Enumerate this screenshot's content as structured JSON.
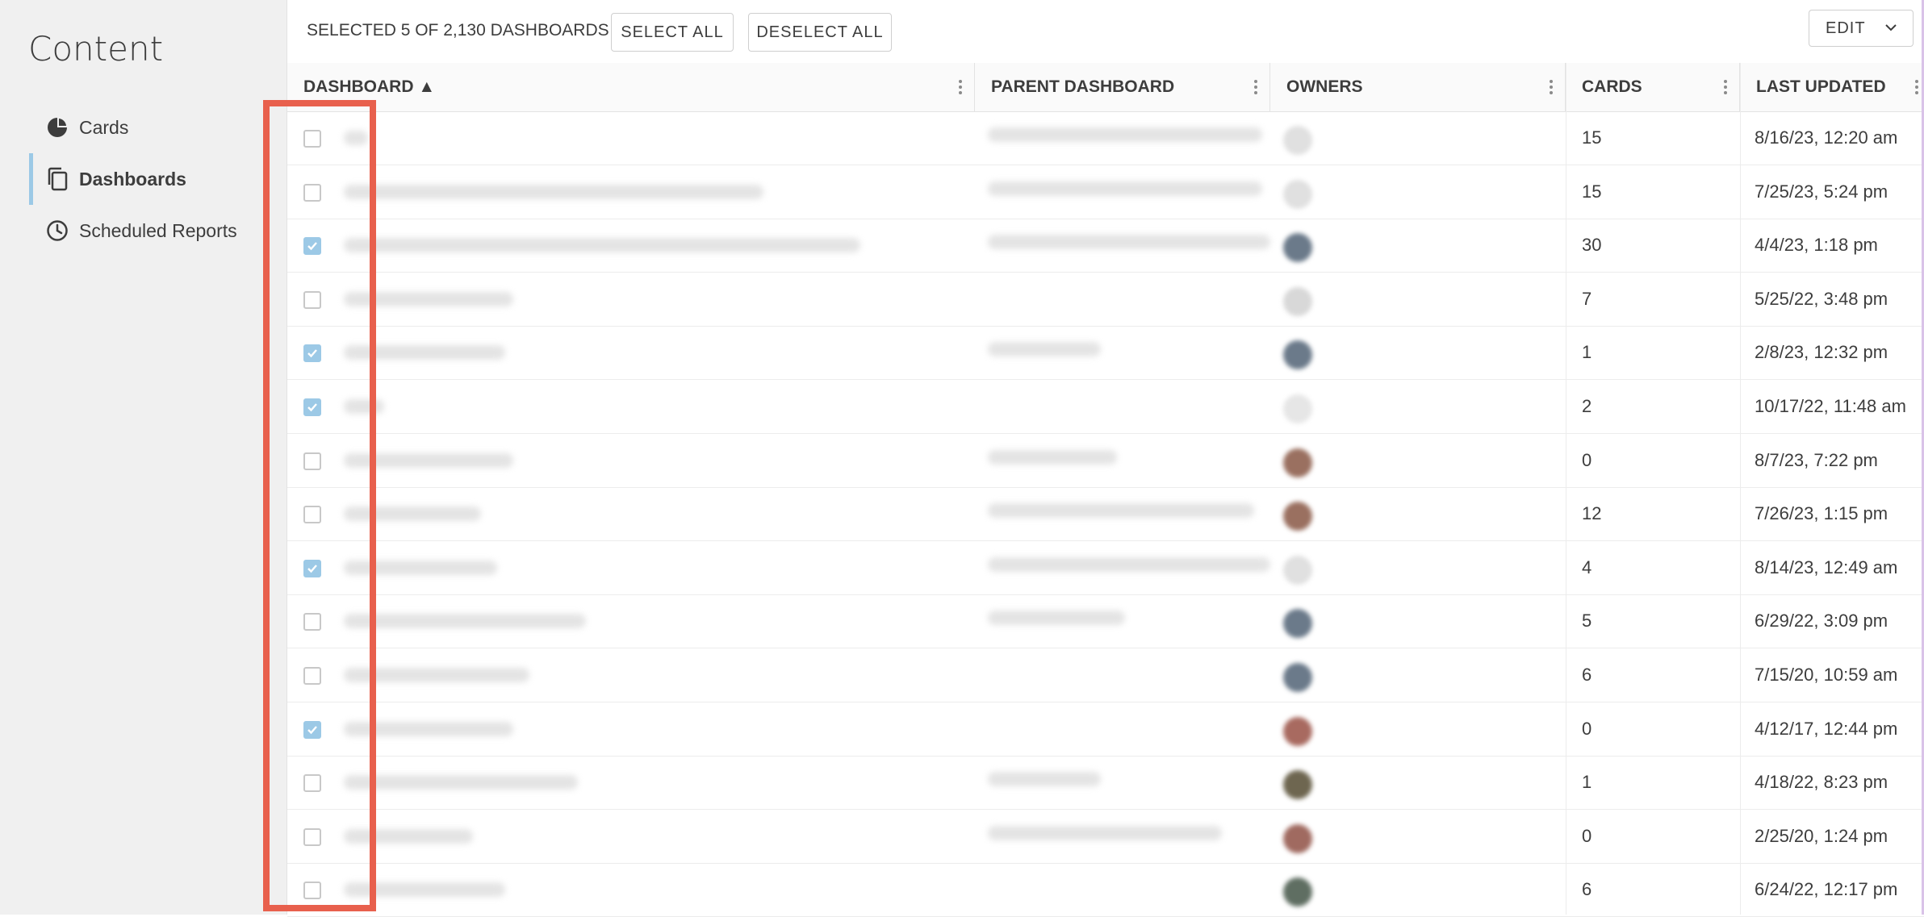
{
  "sidebar": {
    "title": "Content",
    "items": [
      {
        "label": "Cards",
        "icon": "pie-chart-icon",
        "active": false
      },
      {
        "label": "Dashboards",
        "icon": "copy-pages-icon",
        "active": true
      },
      {
        "label": "Scheduled Reports",
        "icon": "clock-icon",
        "active": false
      }
    ]
  },
  "toolbar": {
    "selected_text": "SELECTED 5 OF 2,130 DASHBOARDS",
    "select_all": "SELECT ALL",
    "deselect_all": "DESELECT ALL",
    "edit": "EDIT"
  },
  "table": {
    "columns": [
      "DASHBOARD ▲",
      "PARENT DASHBOARD",
      "OWNERS",
      "CARDS",
      "LAST UPDATED"
    ],
    "rows": [
      {
        "checked": false,
        "cards": "15",
        "last_updated": "8/16/23, 12:20 am"
      },
      {
        "checked": false,
        "cards": "15",
        "last_updated": "7/25/23, 5:24 pm"
      },
      {
        "checked": true,
        "cards": "30",
        "last_updated": "4/4/23, 1:18 pm"
      },
      {
        "checked": false,
        "cards": "7",
        "last_updated": "5/25/22, 3:48 pm"
      },
      {
        "checked": true,
        "cards": "1",
        "last_updated": "2/8/23, 12:32 pm"
      },
      {
        "checked": true,
        "cards": "2",
        "last_updated": "10/17/22, 11:48 am"
      },
      {
        "checked": false,
        "cards": "0",
        "last_updated": "8/7/23, 7:22 pm"
      },
      {
        "checked": false,
        "cards": "12",
        "last_updated": "7/26/23, 1:15 pm"
      },
      {
        "checked": true,
        "cards": "4",
        "last_updated": "8/14/23, 12:49 am"
      },
      {
        "checked": false,
        "cards": "5",
        "last_updated": "6/29/22, 3:09 pm"
      },
      {
        "checked": false,
        "cards": "6",
        "last_updated": "7/15/20, 10:59 am"
      },
      {
        "checked": true,
        "cards": "0",
        "last_updated": "4/12/17, 12:44 pm"
      },
      {
        "checked": false,
        "cards": "1",
        "last_updated": "4/18/22, 8:23 pm"
      },
      {
        "checked": false,
        "cards": "0",
        "last_updated": "2/25/20, 1:24 pm"
      },
      {
        "checked": false,
        "cards": "6",
        "last_updated": "6/24/22, 12:17 pm"
      }
    ]
  },
  "colors": {
    "accent": "#9cc9e6",
    "highlight": "#e8604d",
    "sidebar_bg": "#f0f0f0"
  }
}
